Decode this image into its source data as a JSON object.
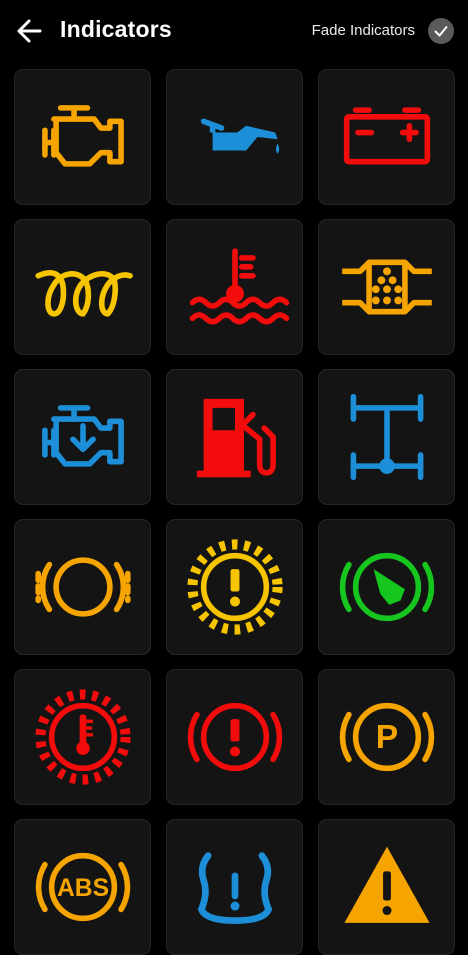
{
  "header": {
    "back_icon": "arrow-left-icon",
    "title": "Indicators",
    "fade_label": "Fade Indicators",
    "fade_icon": "checkmark-icon",
    "fade_checked": true
  },
  "colors": {
    "amber": "#f5a400",
    "yellow": "#f7c400",
    "red": "#f20c0c",
    "blue": "#1c8fd8",
    "green": "#16c61e",
    "tile_bg": "#141414",
    "page_bg": "#000000"
  },
  "indicators": [
    {
      "name": "check-engine-icon",
      "color": "amber"
    },
    {
      "name": "oil-pressure-icon",
      "color": "blue"
    },
    {
      "name": "battery-icon",
      "color": "red"
    },
    {
      "name": "glow-plug-icon",
      "color": "yellow"
    },
    {
      "name": "coolant-temperature-icon",
      "color": "red"
    },
    {
      "name": "diesel-particulate-filter-icon",
      "color": "amber"
    },
    {
      "name": "engine-download-icon",
      "color": "blue"
    },
    {
      "name": "fuel-icon",
      "color": "red"
    },
    {
      "name": "four-wheel-drive-icon",
      "color": "blue"
    },
    {
      "name": "brake-pad-wear-icon",
      "color": "amber"
    },
    {
      "name": "transmission-warning-icon",
      "color": "yellow"
    },
    {
      "name": "brake-hold-icon",
      "color": "green"
    },
    {
      "name": "transmission-temperature-icon",
      "color": "red"
    },
    {
      "name": "brake-warning-icon",
      "color": "red"
    },
    {
      "name": "parking-brake-icon",
      "color": "amber"
    },
    {
      "name": "abs-icon",
      "color": "amber",
      "text": "ABS"
    },
    {
      "name": "tire-pressure-icon",
      "color": "blue"
    },
    {
      "name": "warning-triangle-icon",
      "color": "amber"
    }
  ]
}
